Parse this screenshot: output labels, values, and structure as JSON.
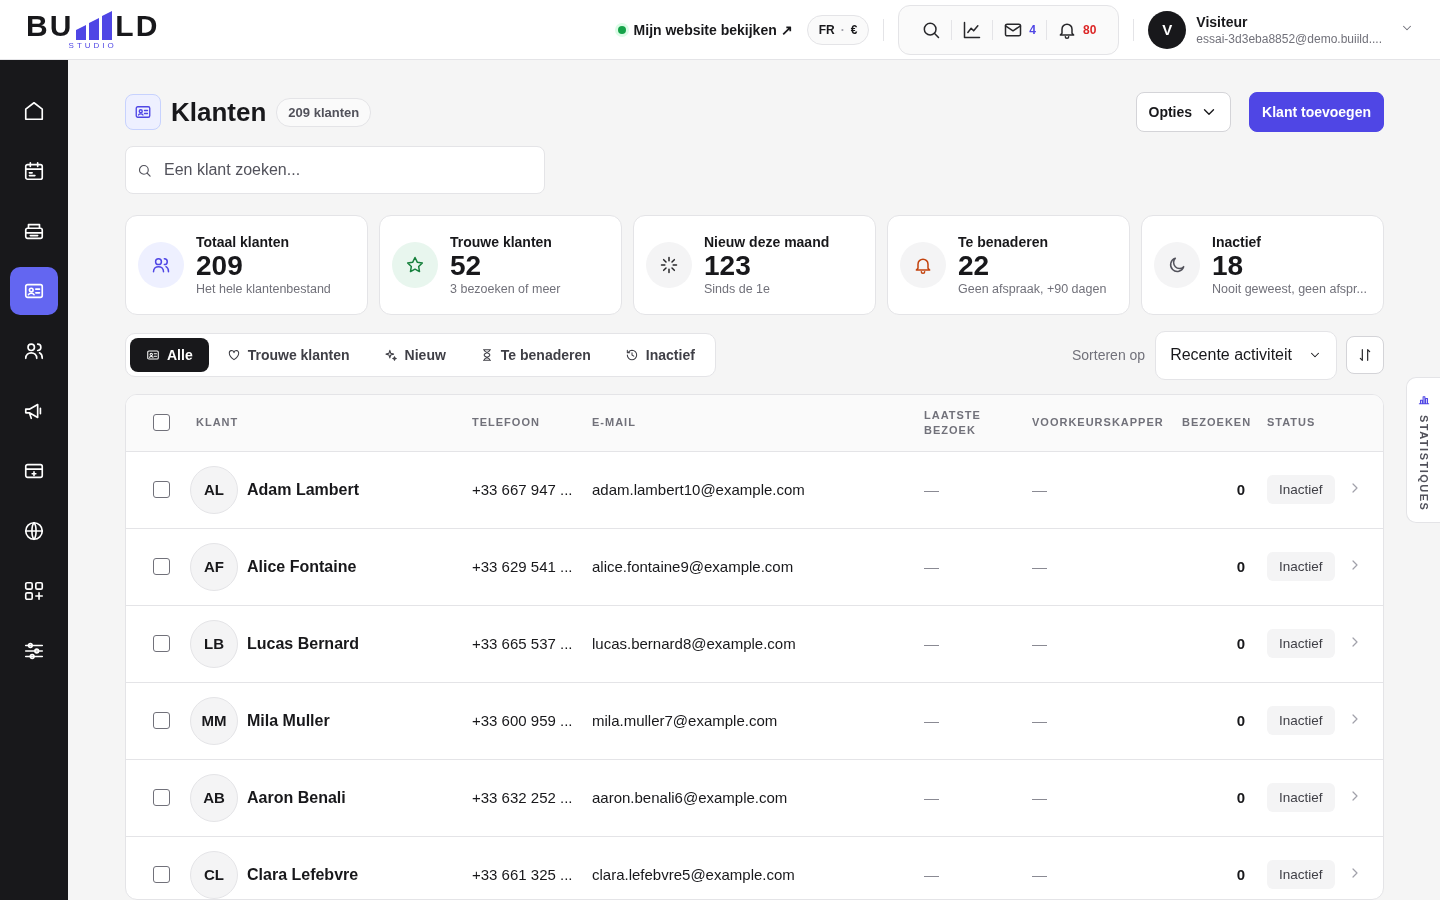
{
  "header": {
    "logo": {
      "left": "BU",
      "right": "LD",
      "sub": "STUDIO"
    },
    "site_link": "Mijn website bekijken ↗",
    "locale": {
      "lang": "FR",
      "sep": "·",
      "currency": "€"
    },
    "mail_count": "4",
    "notification_count": "80",
    "user": {
      "initial": "V",
      "name": "Visiteur",
      "email": "essai-3d3eba8852@demo.buiild...."
    }
  },
  "sidebar": {
    "items": [
      {
        "kind": "home",
        "selected": false
      },
      {
        "kind": "calendar",
        "selected": false
      },
      {
        "kind": "register",
        "selected": false
      },
      {
        "kind": "contact",
        "selected": true
      },
      {
        "kind": "users",
        "selected": false
      },
      {
        "kind": "megaphone",
        "selected": false
      },
      {
        "kind": "card",
        "selected": false
      },
      {
        "kind": "globe",
        "selected": false
      },
      {
        "kind": "apps",
        "selected": false
      },
      {
        "kind": "sliders",
        "selected": false
      }
    ]
  },
  "page": {
    "title": "Klanten",
    "count_badge": "209 klanten",
    "options_button": "Opties",
    "add_button": "Klant toevoegen",
    "search": {
      "placeholder": "Een klant zoeken..."
    }
  },
  "stats": [
    {
      "kind": "users",
      "label": "Totaal klanten",
      "value": "209",
      "note": "Het hele klantenbestand"
    },
    {
      "kind": "star",
      "label": "Trouwe klanten",
      "value": "52",
      "note": "3 bezoeken of meer"
    },
    {
      "kind": "loader",
      "label": "Nieuw deze maand",
      "value": "123",
      "note": "Sinds de 1e"
    },
    {
      "kind": "bell",
      "label": "Te benaderen",
      "value": "22",
      "note": "Geen afspraak, +90 dagen"
    },
    {
      "kind": "moon",
      "label": "Inactief",
      "value": "18",
      "note": "Nooit geweest, geen afspr..."
    }
  ],
  "filters": [
    {
      "kind": "contact",
      "label": "Alle",
      "selected": true
    },
    {
      "kind": "heart",
      "label": "Trouwe klanten",
      "selected": false
    },
    {
      "kind": "sparkle",
      "label": "Nieuw",
      "selected": false
    },
    {
      "kind": "hourglass",
      "label": "Te benaderen",
      "selected": false
    },
    {
      "kind": "history",
      "label": "Inactief",
      "selected": false
    }
  ],
  "sort": {
    "label": "Sorteren op",
    "value": "Recente activiteit"
  },
  "table": {
    "select_all_checked": false,
    "columns": [
      "KLANT",
      "TELEFOON",
      "E-MAIL",
      "LAATSTE BEZOEK",
      "VOORKEURSKAPPER",
      "BEZOEKEN",
      "STATUS"
    ],
    "rows": [
      {
        "checked": false,
        "initials": "AL",
        "name": "Adam Lambert",
        "phone": "+33 667 947 ...",
        "email": "adam.lambert10@example.com",
        "last_visit": "—",
        "stylist": "—",
        "visits": "0",
        "status": "Inactief"
      },
      {
        "checked": false,
        "initials": "AF",
        "name": "Alice Fontaine",
        "phone": "+33 629 541 ...",
        "email": "alice.fontaine9@example.com",
        "last_visit": "—",
        "stylist": "—",
        "visits": "0",
        "status": "Inactief"
      },
      {
        "checked": false,
        "initials": "LB",
        "name": "Lucas Bernard",
        "phone": "+33 665 537 ...",
        "email": "lucas.bernard8@example.com",
        "last_visit": "—",
        "stylist": "—",
        "visits": "0",
        "status": "Inactief"
      },
      {
        "checked": false,
        "initials": "MM",
        "name": "Mila Muller",
        "phone": "+33 600 959 ...",
        "email": "mila.muller7@example.com",
        "last_visit": "—",
        "stylist": "—",
        "visits": "0",
        "status": "Inactief"
      },
      {
        "checked": false,
        "initials": "AB",
        "name": "Aaron Benali",
        "phone": "+33 632 252 ...",
        "email": "aaron.benali6@example.com",
        "last_visit": "—",
        "stylist": "—",
        "visits": "0",
        "status": "Inactief"
      },
      {
        "checked": false,
        "initials": "CL",
        "name": "Clara Lefebvre",
        "phone": "+33 661 325 ...",
        "email": "clara.lefebvre5@example.com",
        "last_visit": "—",
        "stylist": "—",
        "visits": "0",
        "status": "Inactief"
      }
    ]
  },
  "side_tab": "STATISTIQUES"
}
